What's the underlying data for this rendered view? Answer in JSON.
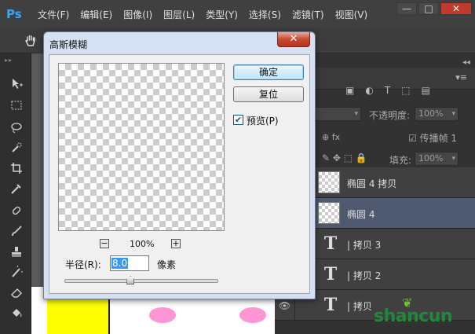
{
  "app": {
    "logo": "Ps",
    "menu": [
      "文件(F)",
      "编辑(E)",
      "图像(I)",
      "图层(L)",
      "类型(Y)",
      "选择(S)",
      "滤镜(T)",
      "视图(V)"
    ],
    "window_buttons": [
      "—",
      "□",
      "✕"
    ]
  },
  "tools": [
    "move-icon",
    "marquee-icon",
    "lasso-icon",
    "quick-select-icon",
    "crop-icon",
    "eyedropper-icon",
    "healing-icon",
    "brush-icon",
    "stamp-icon",
    "history-brush-icon",
    "eraser-icon",
    "paint-bucket-icon"
  ],
  "layers_panel": {
    "opacity_label": "不透明度:",
    "opacity_value": "100%",
    "propagate_label": "传播帧 1",
    "fill_label": "填充:",
    "fill_value": "100%",
    "layers": [
      {
        "name": "椭圆 4 拷贝",
        "kind": "shape",
        "selected": false
      },
      {
        "name": "椭圆 4",
        "kind": "shape",
        "selected": true
      },
      {
        "name": "| 拷贝 3",
        "kind": "text",
        "selected": false
      },
      {
        "name": "| 拷贝 2",
        "kind": "text",
        "selected": false
      },
      {
        "name": "| 拷贝",
        "kind": "text",
        "selected": false
      }
    ]
  },
  "watermark": "shancun",
  "dialog": {
    "title": "高斯模糊",
    "close_label": "✕",
    "ok_label": "确定",
    "reset_label": "复位",
    "preview_label": "预览(P)",
    "preview_checked": true,
    "zoom_out_label": "−",
    "zoom_level": "100%",
    "zoom_in_label": "+",
    "radius_label": "半径(R):",
    "radius_value": "8.0",
    "unit_label": "像素",
    "radius_slider_fraction": 0.43
  },
  "colors": {
    "accent": "#31a8ff",
    "selected_layer": "#4f5a70",
    "dialog_frame": "#d5e1f2",
    "canvas_yellow": "#ffff00",
    "blush_pink": "#ff8ad0"
  }
}
